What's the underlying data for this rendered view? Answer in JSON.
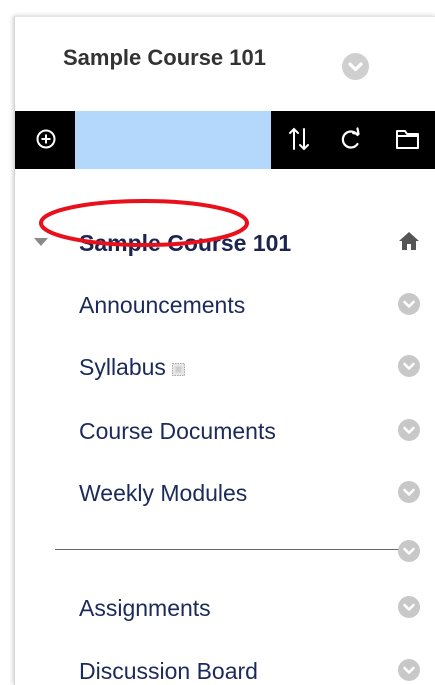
{
  "header": {
    "course_title": "Sample Course 101"
  },
  "toolbar": {
    "add_icon": "add-circle-icon",
    "quick_input_value": "",
    "reorder_icon": "reorder-arrows-icon",
    "refresh_icon": "refresh-icon",
    "folder_icon": "folder-icon"
  },
  "menu": {
    "course": {
      "label": "Sample Course 101",
      "icon": "home-icon"
    },
    "items": [
      {
        "label": "Announcements"
      },
      {
        "label": "Syllabus"
      },
      {
        "label": "Course Documents"
      },
      {
        "label": "Weekly Modules"
      },
      {
        "label": "Assignments"
      },
      {
        "label": "Discussion Board"
      }
    ]
  },
  "colors": {
    "toolbar_bg": "#000000",
    "quick_input_bg": "#b4d8fb",
    "link_text": "#1a2a5a",
    "annotation_ring": "#e8101a",
    "chevron_circle": "#c8c8c8"
  }
}
